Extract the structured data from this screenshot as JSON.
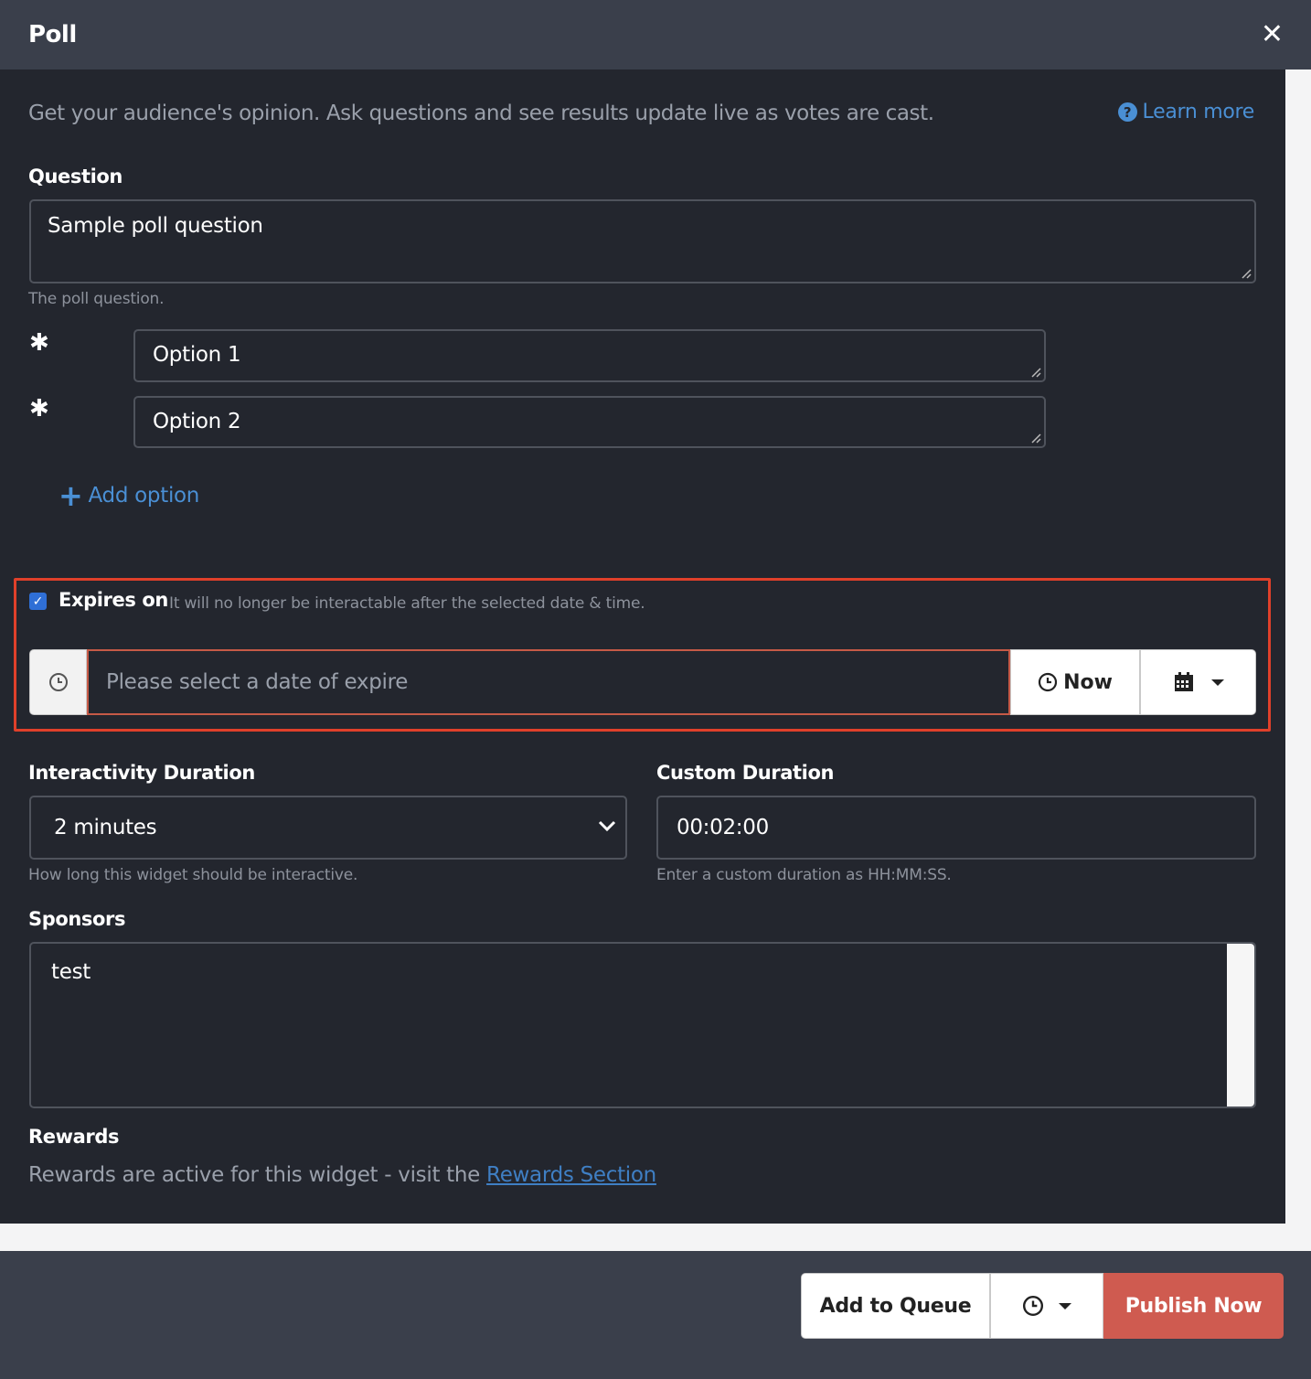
{
  "header": {
    "title": "Poll",
    "close_icon": "close-icon"
  },
  "intro": {
    "text": "Get your audience's opinion. Ask questions and see results update live as votes are cast.",
    "learn_more": "Learn more"
  },
  "question": {
    "label": "Question",
    "value": "Sample poll question",
    "help": "The poll question."
  },
  "options": [
    {
      "marker": "✱",
      "value": "Option 1"
    },
    {
      "marker": "✱",
      "value": "Option 2"
    }
  ],
  "add_option": "Add option",
  "expires": {
    "checked": true,
    "label": "Expires on",
    "help": "It will no longer be interactable after the selected date & time.",
    "placeholder": "Please select a date of expire",
    "now_label": "Now"
  },
  "interactivity": {
    "label": "Interactivity Duration",
    "selected": "2 minutes",
    "help": "How long this widget should be interactive."
  },
  "custom_duration": {
    "label": "Custom Duration",
    "value": "00:02:00",
    "help": "Enter a custom duration as HH:MM:SS."
  },
  "sponsors": {
    "label": "Sponsors",
    "value": "test"
  },
  "rewards": {
    "label": "Rewards",
    "text": "Rewards are active for this widget - visit the ",
    "link": "Rewards Section"
  },
  "footer": {
    "add_to_queue": "Add to Queue",
    "publish_now": "Publish Now"
  },
  "colors": {
    "header_bg": "#3a3f4b",
    "body_bg": "#23262e",
    "accent": "#4a8fd4",
    "highlight_border": "#e0402a",
    "publish": "#cf5b50"
  }
}
